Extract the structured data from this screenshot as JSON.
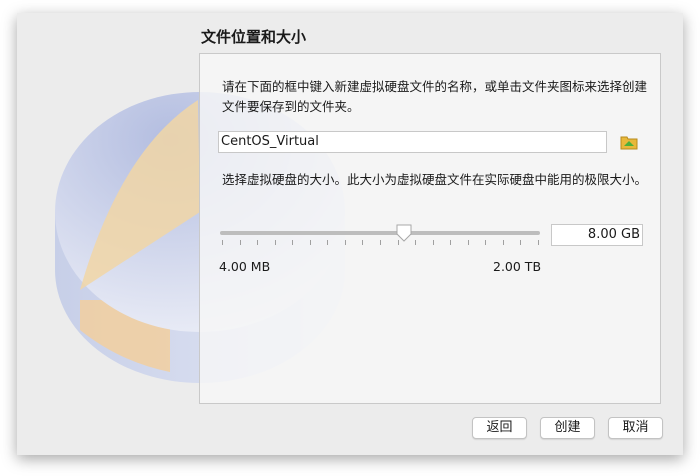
{
  "title": "文件位置和大小",
  "location": {
    "description": "请在下面的框中键入新建虚拟硬盘文件的名称，或单击文件夹图标来选择创建文件要保存到的文件夹。",
    "filename": "CentOS_Virtual",
    "folder_icon": "folder-icon"
  },
  "size": {
    "description": "选择虚拟硬盘的大小。此大小为虚拟硬盘文件在实际硬盘中能用的极限大小。",
    "value": "8.00 GB",
    "slider_fraction": 0.575,
    "min_label": "4.00 MB",
    "max_label": "2.00 TB"
  },
  "buttons": {
    "back": "返回",
    "create": "创建",
    "cancel": "取消"
  }
}
